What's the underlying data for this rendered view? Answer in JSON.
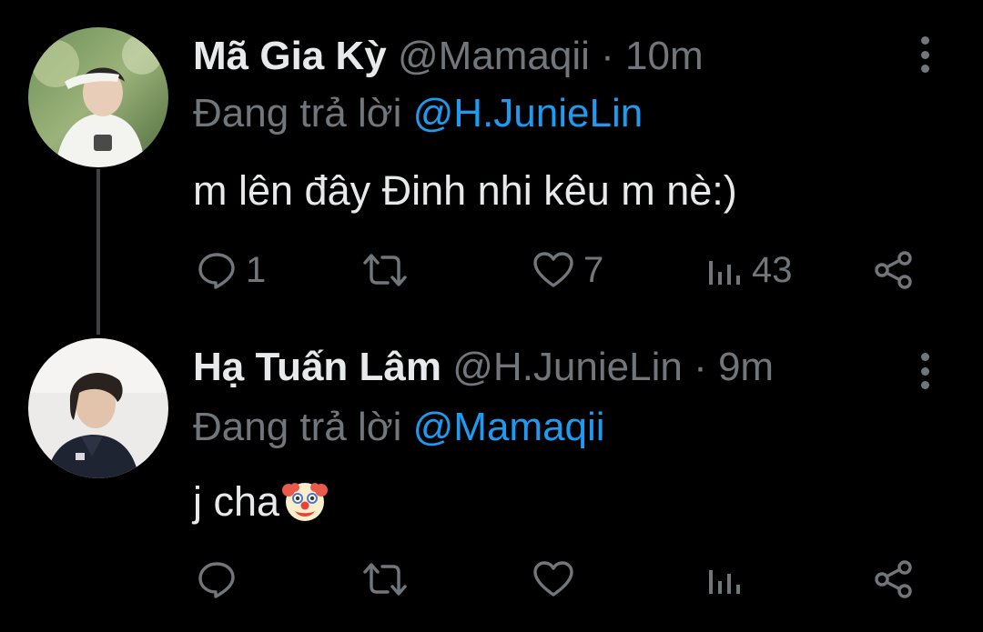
{
  "colors": {
    "background": "#000000",
    "text": "#e7e9ea",
    "muted": "#71767b",
    "link": "#1d9bf0",
    "thread_line": "#3e4144"
  },
  "tweets": [
    {
      "name": "Mã Gia Kỳ",
      "handle": "@Mamaqii",
      "separator": "·",
      "time": "10m",
      "reply_prefix": "Đang trả lời",
      "reply_mention": "@H.JunieLin",
      "text": "m lên đây Đinh nhi kêu m nè:)",
      "reply_count": "1",
      "retweet_count": "",
      "like_count": "7",
      "view_count": "43",
      "avatar_icon": "avatar-photo-person-saluting"
    },
    {
      "name": "Hạ Tuấn Lâm",
      "handle": "@H.JunieLin",
      "separator": "·",
      "time": "9m",
      "reply_prefix": "Đang trả lời",
      "reply_mention": "@Mamaqii",
      "text": "j cha",
      "emoji": "clown-face",
      "reply_count": "",
      "retweet_count": "",
      "like_count": "",
      "view_count": "",
      "avatar_icon": "avatar-photo-person-profile"
    }
  ],
  "icons": {
    "reply": "reply-icon",
    "retweet": "retweet-icon",
    "like": "heart-icon",
    "views": "views-chart-icon",
    "share": "share-icon",
    "more": "more-vertical-icon"
  }
}
